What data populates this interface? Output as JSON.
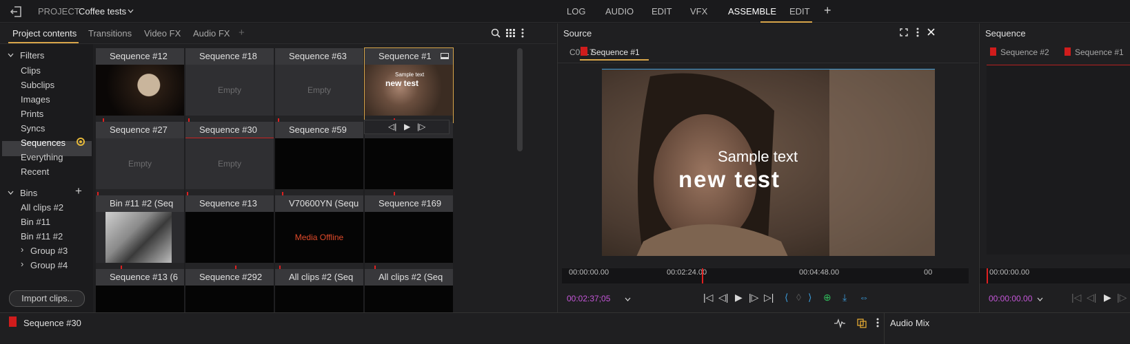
{
  "project": {
    "label": "PROJECT",
    "name": "Coffee tests"
  },
  "top_tabs": [
    "LOG",
    "AUDIO",
    "EDIT",
    "VFX",
    "ASSEMBLE",
    "EDIT"
  ],
  "panel_tabs": [
    "Project contents",
    "Transitions",
    "Video FX",
    "Audio FX",
    "+"
  ],
  "sidebar": {
    "filters_label": "Filters",
    "filters": [
      "Clips",
      "Subclips",
      "Images",
      "Prints",
      "Syncs",
      "Sequences",
      "Everything",
      "Recent"
    ],
    "bins_label": "Bins",
    "bins": [
      "All clips #2",
      "Bin #11",
      "Bin #11 #2",
      "Group #3",
      "Group #4"
    ],
    "import_button": "Import clips.."
  },
  "tiles": [
    {
      "title": "Sequence #12",
      "body": ""
    },
    {
      "title": "Sequence #18",
      "body": "Empty"
    },
    {
      "title": "Sequence #63",
      "body": "Empty"
    },
    {
      "title": "Sequence #1",
      "body": ""
    },
    {
      "title": "Sequence #27",
      "body": "Empty"
    },
    {
      "title": "Sequence #30",
      "body": "Empty"
    },
    {
      "title": "Sequence #59",
      "body": ""
    },
    {
      "title": "",
      "body": ""
    },
    {
      "title": "Bin #11 #2 (Seq",
      "body": ""
    },
    {
      "title": "Sequence #13",
      "body": ""
    },
    {
      "title": "V70600YN (Sequ",
      "body": "Media Offline"
    },
    {
      "title": "Sequence #169",
      "body": ""
    },
    {
      "title": "Sequence #13 (6",
      "body": ""
    },
    {
      "title": "Sequence #292",
      "body": ""
    },
    {
      "title": "All clips #2 (Seq",
      "body": ""
    },
    {
      "title": "All clips #2 (Seq",
      "body": ""
    }
  ],
  "source": {
    "title": "Source",
    "clip_tabs": [
      "C0017",
      "Sequence #1"
    ],
    "overlay_small": "Sample text",
    "overlay_big": "new test",
    "ruler_ticks": [
      "00:00:00.00",
      "00:02:24.00",
      "00:04:48.00",
      "00"
    ],
    "timecode": "00:02:37;05"
  },
  "sequence_panel": {
    "title": "Sequence",
    "tabs": [
      "Sequence #2",
      "Sequence #1"
    ],
    "ruler_tick": "00:00:00.00",
    "timecode": "00:00:00.00"
  },
  "bottom": {
    "sequence_name": "Sequence #30",
    "audio_mix": "Audio Mix"
  },
  "colors": {
    "accent": "#d9a64a",
    "flag": "#d01c1c",
    "timecode": "#c456d8"
  }
}
